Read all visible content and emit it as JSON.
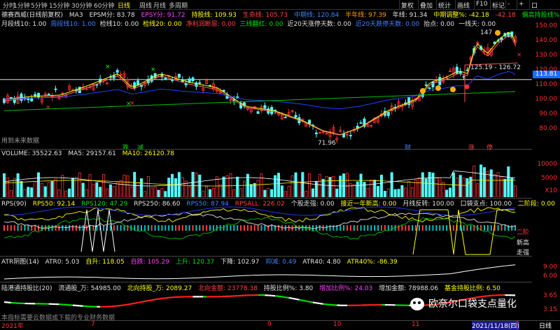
{
  "toolbar": {
    "left": [
      "分时",
      "1分钟",
      "5分钟",
      "15分钟",
      "30分钟",
      "60分钟",
      "日线",
      "周线",
      "月线",
      "多周期"
    ],
    "active": "日线",
    "right": [
      "复权",
      "叠加",
      "统计",
      "画线",
      "F10",
      "标记",
      "-",
      "+",
      "口"
    ]
  },
  "main_panel": {
    "title": "德赛西威(日线前复权)",
    "ma3": "MA3",
    "epsm": "EPSM分: 83.78",
    "epsy": "EPSY分: 91.72",
    "hold": "持股线: 109.93",
    "life": "生命线: 105.73",
    "midline": "中期线: 120.84",
    "halfyear": "半年线: 97.39",
    "year": "年线: 91.34",
    "midadj": "中期调整%: -42.18",
    "midadj2": "-42.18",
    "highhold": "偏高持股线%: 3.53",
    "row2": [
      "月段线10: 1.00",
      "周段线10: 1.00",
      "检线10: 0.00",
      "检线20: 0.00",
      "净利润断层: 0.00",
      "三线翻红: 0.00",
      "近20天涨停天数: 0.00",
      "近20天跌停天数: 0.00",
      "抬点: 0.00",
      "一线天: 0.00"
    ],
    "future_text": "用到未来数据",
    "markers": {
      "low": "71.96",
      "high": "147",
      "range": "125.19 - 126.72",
      "cai": "财",
      "red": "涨",
      "jie": "跌",
      "jian": "减",
      "ting": "停"
    },
    "axis": [
      "150.00",
      "140.00",
      "130.00",
      "120.00",
      "110.00",
      "100.00",
      "90.00",
      "80.00"
    ],
    "price_tag": "113.81"
  },
  "volume_panel": {
    "title": "VOLUME: 35522.63",
    "ma5": "MA5: 29157.61",
    "ma10": "MA10: 26120.78",
    "axis": [
      "10000",
      "5000"
    ],
    "unit": "X10"
  },
  "rps_panel": {
    "title": "RPS(90)",
    "rps50": "RPS50: 92.14",
    "rps120": "RPS120: 47.29",
    "rps250": "RPS250: 86.60",
    "rps_mid": "RPS50: 87.94",
    "rpsall": "RPSALL: 226.02",
    "stock_strong": "个股走强: 0.00",
    "near_high": "接近一年新高: 0.00",
    "month_turn": "月线反转: 100.00",
    "pocket": "口袋支点: 100.00",
    "second_fall": "二阶段: 0.00",
    "tags": [
      "二阶",
      "新高",
      "走强"
    ]
  },
  "atr_panel": {
    "title": "ATR阴图(14)",
    "atr0": "ATR0: 5.03",
    "s1": "自升: 118.05",
    "s2": "自跌: 105.29",
    "up": "上升: 120.37",
    "down": "下降: 102.97",
    "blue": "抑减: 0.49",
    "atr40": "ATR40: 4.80",
    "atr40p": "ATR40%: -86.39",
    "axis": [
      "9.00",
      "6.00"
    ]
  },
  "hk_panel": {
    "title": "陆港通持股比(20)",
    "float": "流通股_万: 54985.00",
    "north": "北向持股_万: 2089.27",
    "north_amt": "北向金额: 23778.38",
    "ratio": "持股比例%: 3.80",
    "inc": "增加比例%: 24.03",
    "inc_amt": "增加金额: 78988.06",
    "fund": "基金持股比例: 6.50",
    "axis": [
      "3.65",
      "3.15"
    ],
    "footnote": "本指标需要云数据或下载的专业财务数据"
  },
  "dates": {
    "d1": "2021年",
    "d2": "7",
    "d3": "9",
    "d4": "10",
    "d5": "11",
    "d6": "2021/11/18(四)",
    "d7": "2"
  },
  "bottom_tab": "日线",
  "watermark": "欧奈尔口袋支点量化",
  "colors": {
    "up": "#ff3232",
    "down": "#54fcfc",
    "ma_yellow": "#ffff00",
    "ma_blue": "#2040ff",
    "ma_green": "#00c000"
  }
}
